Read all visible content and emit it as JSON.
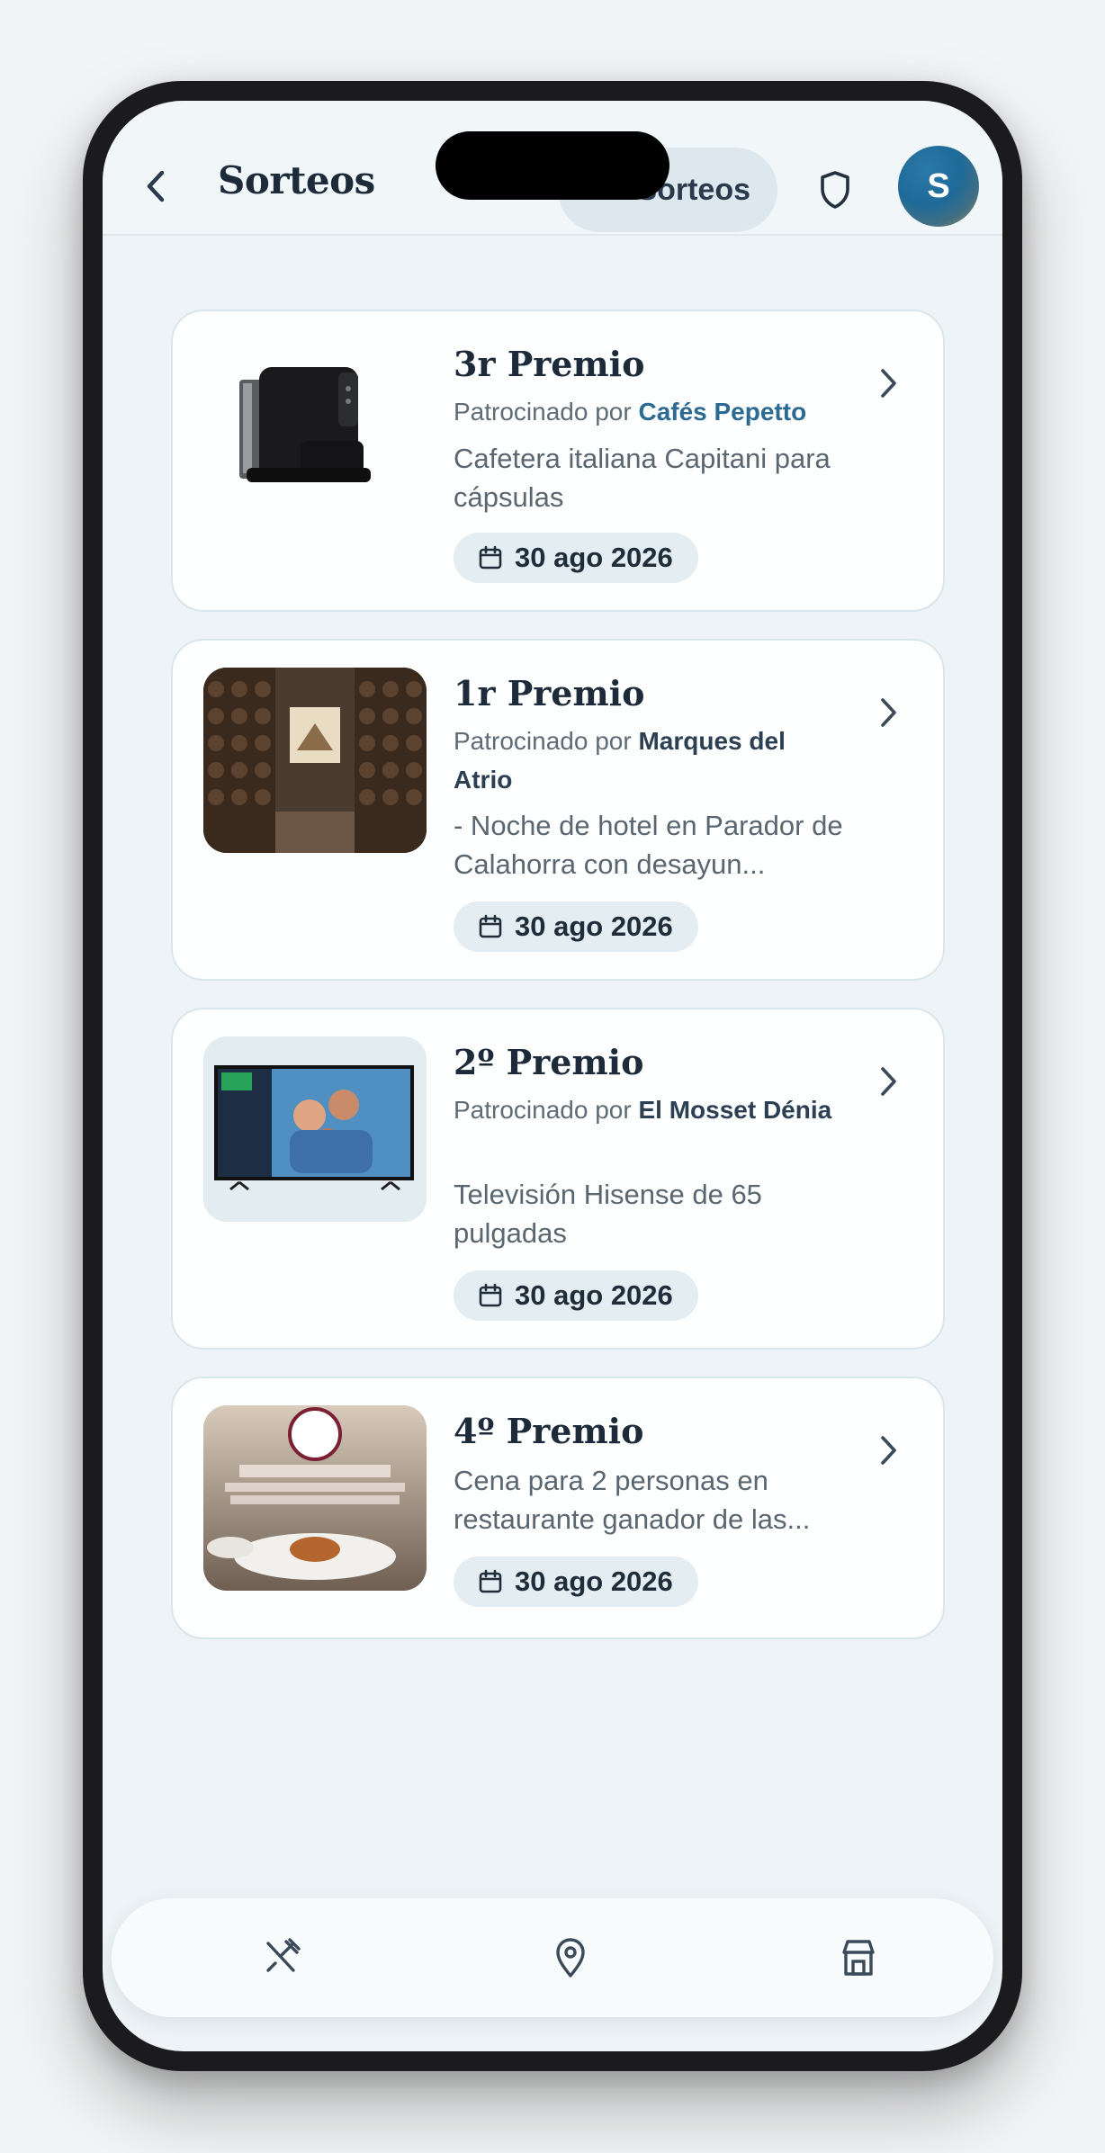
{
  "header": {
    "title": "Sorteos",
    "pill_label": "Sorteos",
    "avatar_initial": "S"
  },
  "icons": {
    "back": "chevron-left-icon",
    "shield": "shield-icon",
    "chevron": "chevron-right-icon",
    "calendar": "calendar-icon"
  },
  "cards": [
    {
      "title": "3r Premio",
      "sponsor_prefix": "Patrocinado por",
      "sponsor_name": "Cafés Pepetto",
      "description": "Cafetera italiana Capitani para cápsulas",
      "date": "30 ago 2026",
      "image": "coffee-machine"
    },
    {
      "title": "1r Premio",
      "sponsor_prefix": "Patrocinado por",
      "sponsor_name": "Marques del Atrio",
      "description": "- Noche de hotel en Parador de Calahorra con desayun...",
      "date": "30 ago 2026",
      "image": "wine-cellar"
    },
    {
      "title": "2º Premio",
      "sponsor_prefix": "Patrocinado por",
      "sponsor_name": "El Mosset Dénia",
      "description": "Televisión Hisense de 65 pulgadas",
      "date": "30 ago 2026",
      "image": "television"
    },
    {
      "title": "4º Premio",
      "sponsor_prefix": "",
      "sponsor_name": "",
      "description": "Cena para 2 personas en restaurante ganador de las...",
      "date": "30 ago 2026",
      "image": "dinner-plate"
    }
  ],
  "bottom_nav": [
    {
      "icon": "utensils-icon"
    },
    {
      "icon": "map-pin-icon"
    },
    {
      "icon": "store-icon"
    }
  ]
}
